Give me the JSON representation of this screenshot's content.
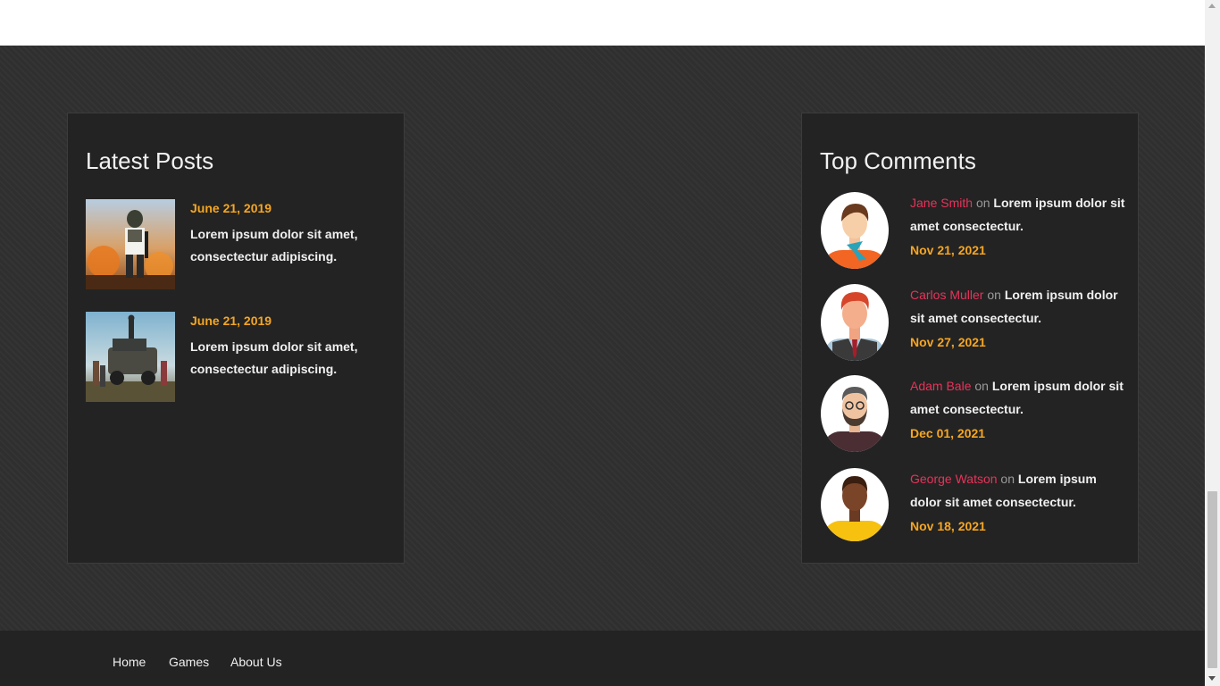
{
  "latest_posts": {
    "title": "Latest Posts",
    "posts": [
      {
        "date": "June 21, 2019",
        "text": "Lorem ipsum dolor sit amet, consectectur adipiscing.",
        "thumb": "soldier-parachute-image"
      },
      {
        "date": "June 21, 2019",
        "text": "Lorem ipsum dolor sit amet, consectectur adipiscing.",
        "thumb": "squad-on-vehicle-image"
      }
    ]
  },
  "top_comments": {
    "title": "Top Comments",
    "comments": [
      {
        "author": "Jane Smith",
        "on": "on",
        "text": "Lorem ipsum dolor sit amet consectectur.",
        "date": "Nov 21, 2021",
        "avatar": "woman-scarf-avatar"
      },
      {
        "author": "Carlos Muller",
        "on": "on",
        "text": "Lorem ipsum dolor sit amet consectectur.",
        "date": "Nov 27, 2021",
        "avatar": "man-vest-tie-avatar"
      },
      {
        "author": "Adam Bale",
        "on": "on",
        "text": "Lorem ipsum dolor sit amet consectectur.",
        "date": "Dec 01, 2021",
        "avatar": "man-beard-glasses-avatar"
      },
      {
        "author": "George Watson",
        "on": "on",
        "text": "Lorem ipsum dolor sit amet consectectur.",
        "date": "Nov 18, 2021",
        "avatar": "man-yellow-shirt-avatar"
      }
    ]
  },
  "footer": {
    "links": [
      "Home",
      "Games",
      "About Us"
    ]
  },
  "colors": {
    "date_accent": "#f5a623",
    "author_accent": "#e8335a",
    "widget_bg": "#232323",
    "page_bg": "#2f2f2f"
  }
}
